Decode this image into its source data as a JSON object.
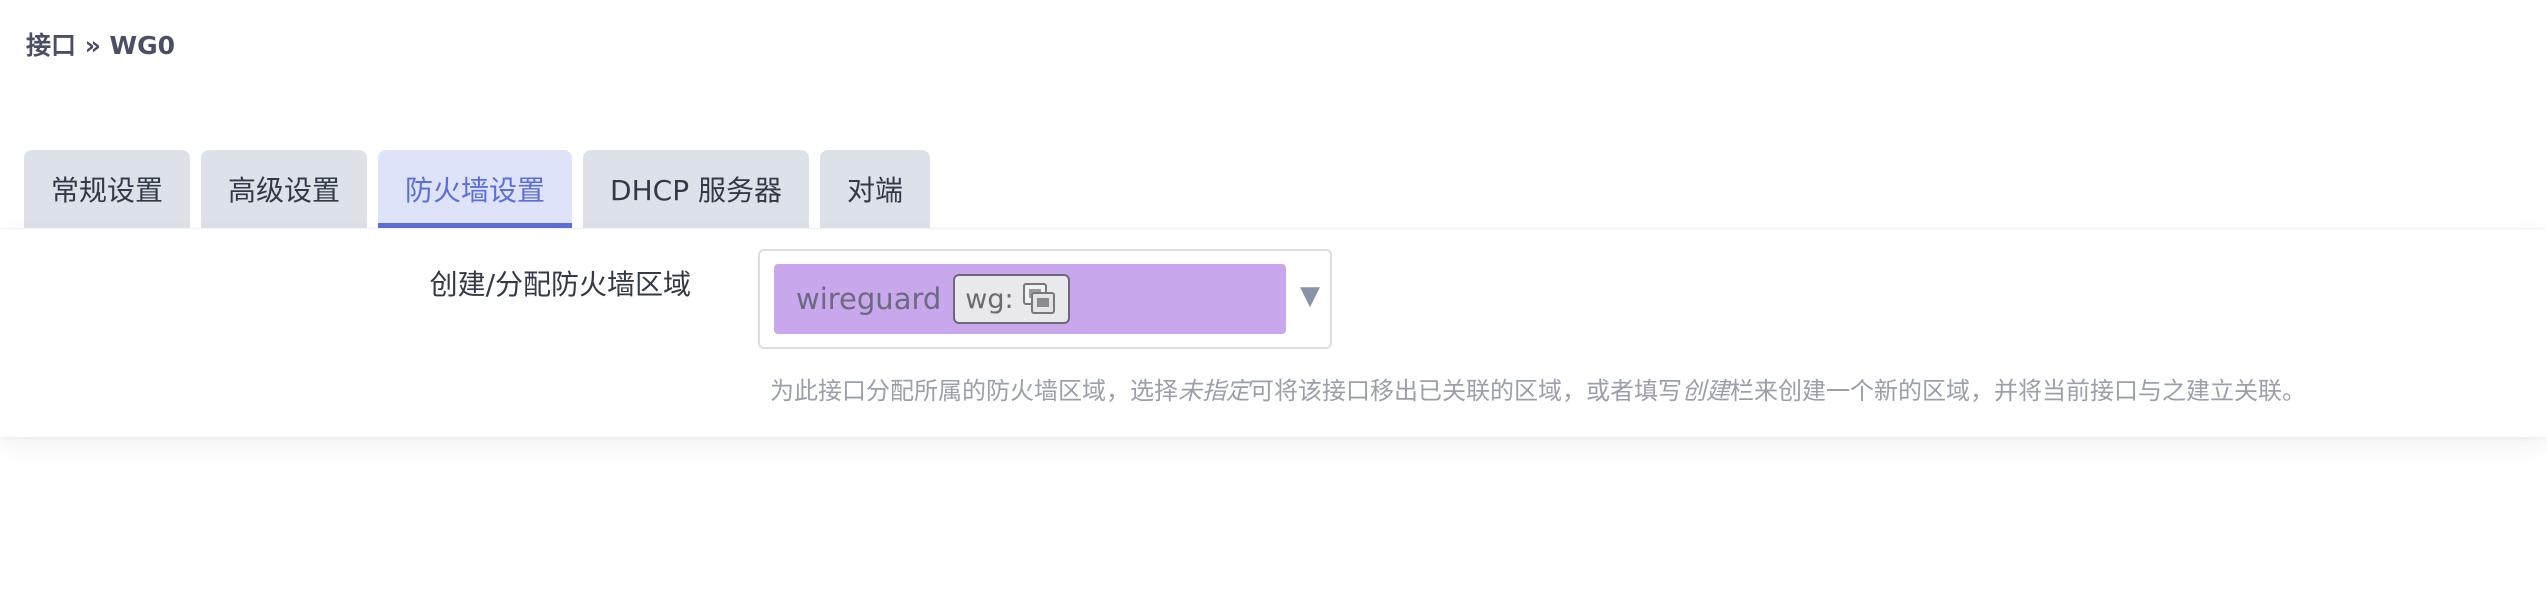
{
  "breadcrumb": "接口 » WG0",
  "tabs": [
    {
      "label": "常规设置",
      "active": false
    },
    {
      "label": "高级设置",
      "active": false
    },
    {
      "label": "防火墙设置",
      "active": true
    },
    {
      "label": "DHCP 服务器",
      "active": false
    },
    {
      "label": "对端",
      "active": false
    }
  ],
  "firewall": {
    "field_label": "创建/分配防火墙区域",
    "selected_zone": "wireguard",
    "network_tag": "wg:",
    "network_icon": "ethernet-ports-icon",
    "help": {
      "part1": "为此接口分配所属的防火墙区域，选择",
      "em1": "未指定",
      "part2": "可将该接口移出已关联的区域，或者填写",
      "em2": "创建",
      "part3": "栏来创建一个新的区域，并将当前接口与之建立关联。"
    }
  },
  "colors": {
    "active_tab": "#5b6fd8",
    "zone_chip": "#c9a7ec",
    "tab_bg": "#dde2e8"
  }
}
